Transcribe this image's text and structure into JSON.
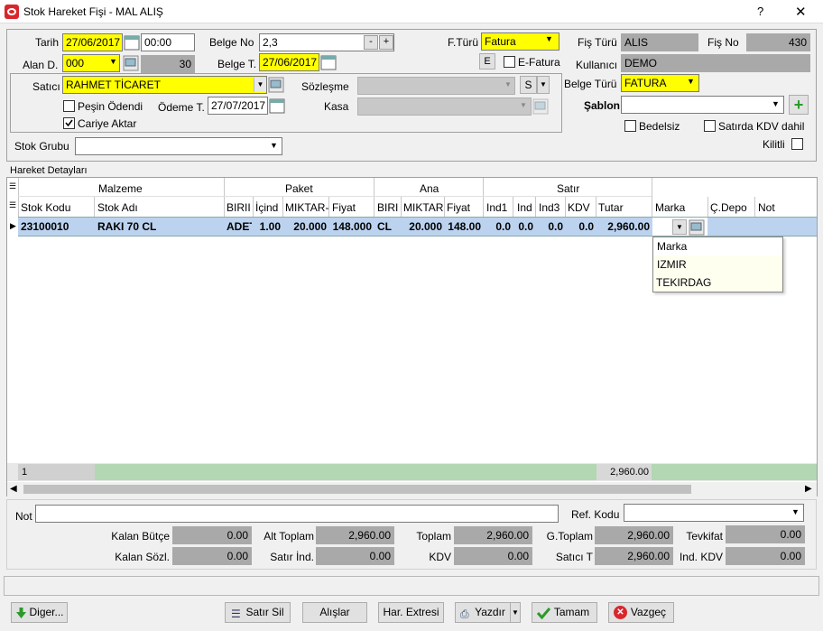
{
  "window": {
    "title": "Stok Hareket Fişi - MAL ALIŞ",
    "help": "?",
    "close": "✕"
  },
  "header": {
    "tarih_label": "Tarih",
    "tarih": "27/06/2017",
    "saat": "00:00",
    "belge_no_label": "Belge No",
    "belge_no": "2,3",
    "minus": "-",
    "plus": "+",
    "fturu_label": "F.Türü",
    "fturu": "Fatura",
    "fis_turu_label": "Fiş Türü",
    "fis_turu": "ALIS",
    "fis_no_label": "Fiş No",
    "fis_no": "430",
    "alan_d_label": "Alan D.",
    "alan_d": "000",
    "alan_d_num": "30",
    "belge_t_label": "Belge T.",
    "belge_t": "27/06/2017",
    "e_btn": "E",
    "efatura_label": "E-Fatura",
    "kullanici_label": "Kullanıcı",
    "kullanici": "DEMO",
    "satici_label": "Satıcı",
    "satici": "RAHMET TİCARET",
    "sozlesme_label": "Sözleşme",
    "s_btn": "S",
    "pesin_label": "Peşin Ödendi",
    "odeme_label": "Ödeme T.",
    "odeme": "27/07/2017",
    "kasa_label": "Kasa",
    "cariye_label": "Cariye Aktar",
    "belge_turu_label": "Belge Türü",
    "belge_turu": "FATURA",
    "sablon_label": "Şablon",
    "bedelsiz_label": "Bedelsiz",
    "satirda_kdv_label": "Satırda KDV dahil",
    "kilitli_label": "Kilitli",
    "stok_grubu_label": "Stok Grubu"
  },
  "grid": {
    "section_label": "Hareket Detayları",
    "groups": {
      "malzeme": "Malzeme",
      "paket": "Paket",
      "ana": "Ana",
      "satir": "Satır"
    },
    "cols": {
      "stok_kodu": "Stok Kodu",
      "stok_adi": "Stok Adı",
      "birim": "BIRII",
      "icind": "İçind",
      "miktar": "MIKTAR-",
      "fiyat": "Fiyat",
      "ana_bir": "BIRI",
      "ana_miktar": "MIKTAR",
      "ana_fiyat": "Fiyat",
      "ind1": "Ind1",
      "ind": "Ind",
      "ind3": "Ind3",
      "kdv": "KDV",
      "tutar": "Tutar",
      "marka": "Marka",
      "cdepo": "Ç.Depo",
      "not": "Not"
    },
    "row": {
      "stok_kodu": "23100010",
      "stok_adi": "RAKI 70 CL",
      "birim": "ADET",
      "icind": "1.00",
      "miktar": "20.000",
      "fiyat": "148.000",
      "ana_bir": "CL",
      "ana_miktar": "20.000",
      "ana_fiyat": "148.00",
      "ind1": "0.0",
      "ind": "0.0",
      "ind3": "0.0",
      "kdv": "0.0",
      "tutar": "2,960.00"
    },
    "dropdown": [
      "Marka",
      "IZMIR",
      "TEKIRDAG"
    ],
    "footer_count": "1",
    "footer_total": "2,960.00"
  },
  "bottom": {
    "not_label": "Not",
    "ref_label": "Ref. Kodu",
    "kalan_butce_label": "Kalan Bütçe",
    "kalan_butce": "0.00",
    "alt_toplam_label": "Alt Toplam",
    "alt_toplam": "2,960.00",
    "toplam_label": "Toplam",
    "toplam": "2,960.00",
    "g_toplam_label": "G.Toplam",
    "g_toplam": "2,960.00",
    "tevkifat_label": "Tevkifat",
    "tevkifat": "0.00",
    "kalan_sozl_label": "Kalan Sözl.",
    "kalan_sozl": "0.00",
    "satir_ind_label": "Satır İnd.",
    "satir_ind": "0.00",
    "kdv_label": "KDV",
    "kdv": "0.00",
    "satici_t_label": "Satıcı T",
    "satici_t": "2,960.00",
    "ind_kdv_label": "Ind. KDV",
    "ind_kdv": "0.00"
  },
  "buttons": {
    "diger": "Diger...",
    "satir_sil": "Satır Sil",
    "alislar": "Alışlar",
    "har_extresi": "Har. Extresi",
    "yazdir": "Yazdır",
    "tamam": "Tamam",
    "vazgec": "Vazgeç"
  }
}
